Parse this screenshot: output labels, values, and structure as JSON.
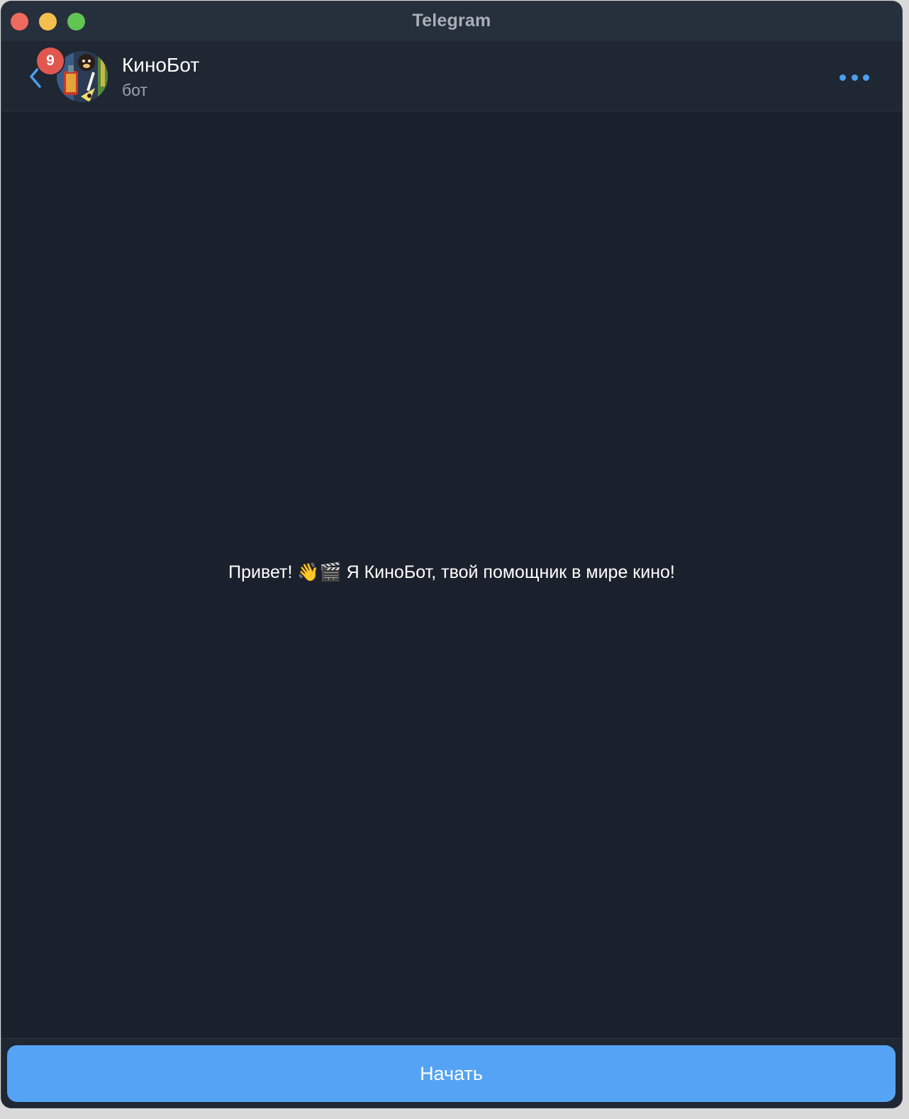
{
  "window": {
    "title": "Telegram"
  },
  "chat": {
    "name": "КиноБот",
    "status": "бот",
    "unread_badge": "9"
  },
  "icons": {
    "back": "chevron-left-icon",
    "more": "more-dots-icon",
    "avatar": "bot-avatar-image"
  },
  "messages": {
    "welcome_text": "Привет! 👋🎬 Я КиноБот, твой помощник в мире кино!"
  },
  "footer": {
    "start_label": "Начать"
  },
  "colors": {
    "background": "#1b212c",
    "header": "#1f2733",
    "titlebar": "#262f3c",
    "accent": "#55a3f5",
    "badge": "#e0574f"
  }
}
